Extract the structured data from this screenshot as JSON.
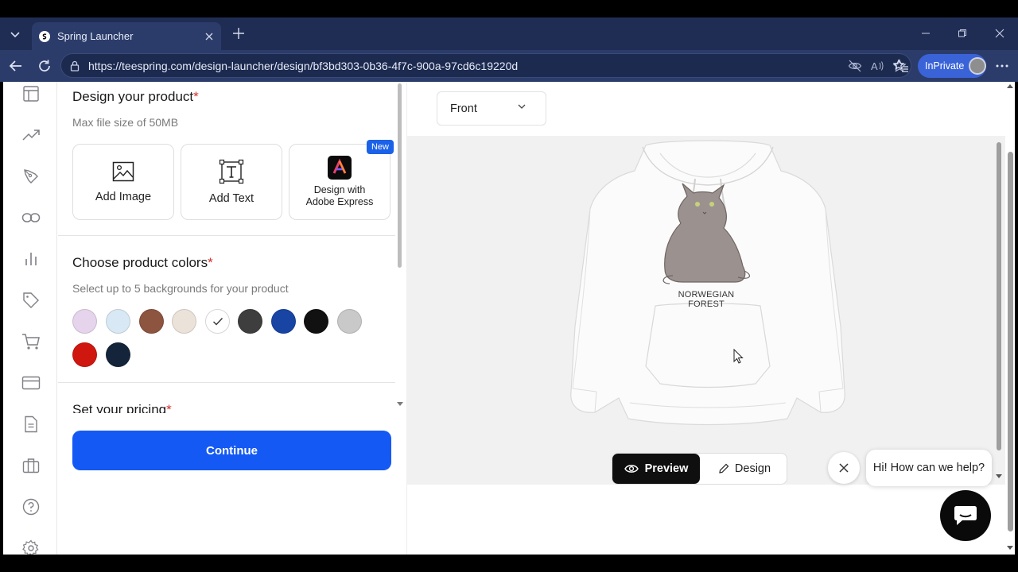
{
  "browser": {
    "tab_title": "Spring Launcher",
    "url": "https://teespring.com/design-launcher/design/bf3bd303-0b36-4f7c-900a-97cd6c19220d",
    "inprivate_label": "InPrivate"
  },
  "sidebar": {
    "icons": [
      "layout-icon",
      "trending-icon",
      "pen-icon",
      "link-icon",
      "bar-chart-icon",
      "tag-icon",
      "cart-icon",
      "credit-card-icon",
      "document-icon",
      "briefcase-icon",
      "help-icon",
      "settings-icon"
    ]
  },
  "design_section": {
    "title": "Design your product",
    "required_mark": "*",
    "subtitle": "Max file size of 50MB",
    "tiles": [
      {
        "label": "Add Image",
        "icon": "image-icon"
      },
      {
        "label": "Add Text",
        "icon": "text-icon"
      },
      {
        "label_line1": "Design with",
        "label_line2": "Adobe Express",
        "icon": "adobe-express-icon",
        "badge": "New"
      }
    ]
  },
  "colors_section": {
    "title": "Choose product colors",
    "required_mark": "*",
    "subtitle": "Select up to 5 backgrounds for your product",
    "swatches": [
      {
        "color": "#e6d4ec",
        "selected": false
      },
      {
        "color": "#d8e8f4",
        "selected": false
      },
      {
        "color": "#8d5440",
        "selected": false
      },
      {
        "color": "#ebe2d9",
        "selected": false
      },
      {
        "color": "#ffffff",
        "selected": true
      },
      {
        "color": "#3e3e3e",
        "selected": false
      },
      {
        "color": "#1844a4",
        "selected": false
      },
      {
        "color": "#111111",
        "selected": false
      },
      {
        "color": "#c9c9c9",
        "selected": false
      },
      {
        "color": "#d0170f",
        "selected": false
      },
      {
        "color": "#14243a",
        "selected": false
      }
    ]
  },
  "pricing_section": {
    "title": "Set your pricing",
    "required_mark": "*"
  },
  "continue_label": "Continue",
  "preview": {
    "view_select": "Front",
    "product_text": "NORWEGIAN FOREST",
    "preview_label": "Preview",
    "design_label": "Design"
  },
  "chat": {
    "bubble_text": "Hi! How can we help?"
  },
  "colors": {
    "accent": "#1559f5",
    "browser_chrome": "#2c3c6a",
    "required": "#d32f2f"
  }
}
